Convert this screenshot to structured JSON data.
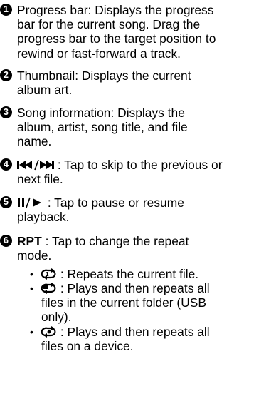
{
  "items": [
    {
      "number": "1",
      "lines": [
        "Progress bar: Displays the progress",
        "bar for the current song. Drag the",
        "progress bar to the target position to",
        "rewind or fast-forward a track."
      ]
    },
    {
      "number": "2",
      "lines": [
        "Thumbnail: Displays the current",
        "album art."
      ]
    },
    {
      "number": "3",
      "lines": [
        "Song information: Displays the",
        "album, artist, song title, and file",
        "name."
      ]
    },
    {
      "number": "4",
      "line1_rest": " : Tap to skip to the previous or",
      "line2": "next file."
    },
    {
      "number": "5",
      "line1_rest": " : Tap to pause or resume",
      "line2": "playback."
    },
    {
      "number": "6",
      "bold_label": "RPT",
      "line1_rest": " : Tap to change the repeat",
      "line2": "mode."
    }
  ],
  "repeat_modes": [
    {
      "bullet": "•",
      "icon": "repeat-one-icon",
      "lines": [
        " : Repeats the current file."
      ]
    },
    {
      "bullet": "•",
      "icon": "repeat-folder-icon",
      "lines": [
        " : Plays and then repeats all",
        "files in the current folder (USB",
        "only)."
      ]
    },
    {
      "bullet": "•",
      "icon": "repeat-all-icon",
      "lines": [
        " : Plays and then repeats all",
        "files on a device."
      ]
    }
  ]
}
